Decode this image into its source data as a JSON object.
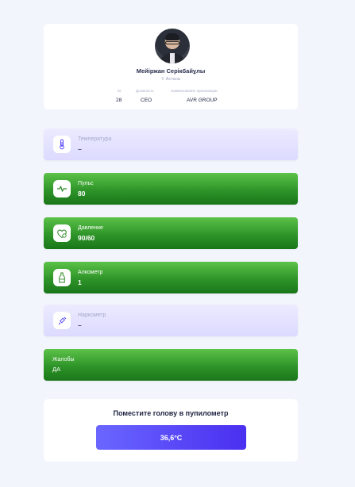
{
  "profile": {
    "name": "Мейіржан Серікбайұлы",
    "city": "Астана",
    "id_label": "ID",
    "id_value": "28",
    "position_label": "Должность",
    "position_value": "CEO",
    "org_label": "Наименование организации",
    "org_value": "AVR GROUP"
  },
  "metrics": {
    "temperature": {
      "label": "Температура",
      "value": "–",
      "icon": "thermometer-icon",
      "status": "neutral"
    },
    "pulse": {
      "label": "Пульс",
      "value": "80",
      "icon": "pulse-icon",
      "status": "ok"
    },
    "pressure": {
      "label": "Давление",
      "value": "90/60",
      "icon": "heart-pressure-icon",
      "status": "ok"
    },
    "alcometer": {
      "label": "Алкометр",
      "value": "1",
      "icon": "bottle-icon",
      "status": "ok"
    },
    "narcometer": {
      "label": "Наркометр",
      "value": "–",
      "icon": "syringe-icon",
      "status": "neutral"
    },
    "complaints": {
      "label": "Жалобы",
      "value": "ДА",
      "status": "ok"
    }
  },
  "pupilometer": {
    "title": "Поместите голову в пупилометр",
    "button_label": "36,6°C"
  },
  "colors": {
    "ok": "#2e9429",
    "neutral": "#dcdaff",
    "accent": "#5b4cff",
    "background": "#f3f5fd"
  }
}
